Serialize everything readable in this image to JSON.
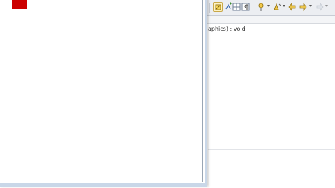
{
  "app_window": {
    "shape_color": "#cc0000",
    "background_color": "#ffffff"
  },
  "ide": {
    "toolbar": {
      "icons": [
        "paint-icon",
        "add-marker-icon",
        "grid-icon",
        "paragraph-icon",
        "pin-icon",
        "annotation-icon",
        "back-icon",
        "forward-icon"
      ]
    },
    "outline_text": "aphics) : void"
  }
}
